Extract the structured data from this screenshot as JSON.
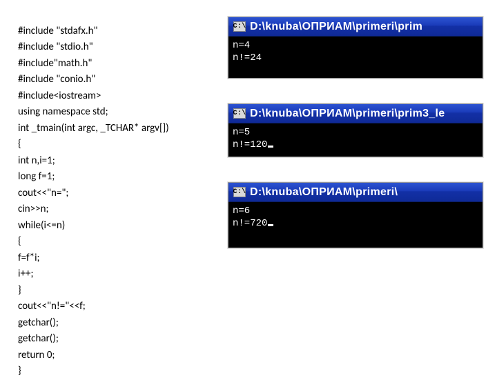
{
  "code": {
    "l0": "#include \"stdafx.h\"",
    "l1": "#include \"stdio.h\"",
    "l2": "#include\"math.h\"",
    "l3": "#include \"conio.h\"",
    "l4": "#include<iostream>",
    "l5": "using namespace std;",
    "l6": "int _tmain(int argc, _TCHAR* argv[])",
    "l7": "{",
    "l8": "int n,i=1;",
    "l9": "long f=1;",
    "l10": "cout<<\"n=\";",
    "l11": "cin>>n;",
    "l12": "while(i<=n)",
    "l13": "{",
    "l14": "f=f*i;",
    "l15": "i++;",
    "l16": "}",
    "l17": "cout<<\"n!=\"<<f;",
    "l18": "getchar();",
    "l19": "getchar();",
    "l20": "return 0;",
    "l21": "}"
  },
  "consoles": [
    {
      "icon_text": "C:\\",
      "title": "D:\\knuba\\ОПРИАМ\\primeri\\prim",
      "line1": "n=4",
      "line2": "n!=24",
      "cursor": false
    },
    {
      "icon_text": "C:\\",
      "title": "D:\\knuba\\ОПРИАМ\\primeri\\prim3_le",
      "line1": "n=5",
      "line2": "n!=120",
      "cursor": true
    },
    {
      "icon_text": "C:\\",
      "title": "D:\\knuba\\ОПРИАМ\\primeri\\",
      "line1": "n=6",
      "line2": "n!=720",
      "cursor": true
    }
  ]
}
